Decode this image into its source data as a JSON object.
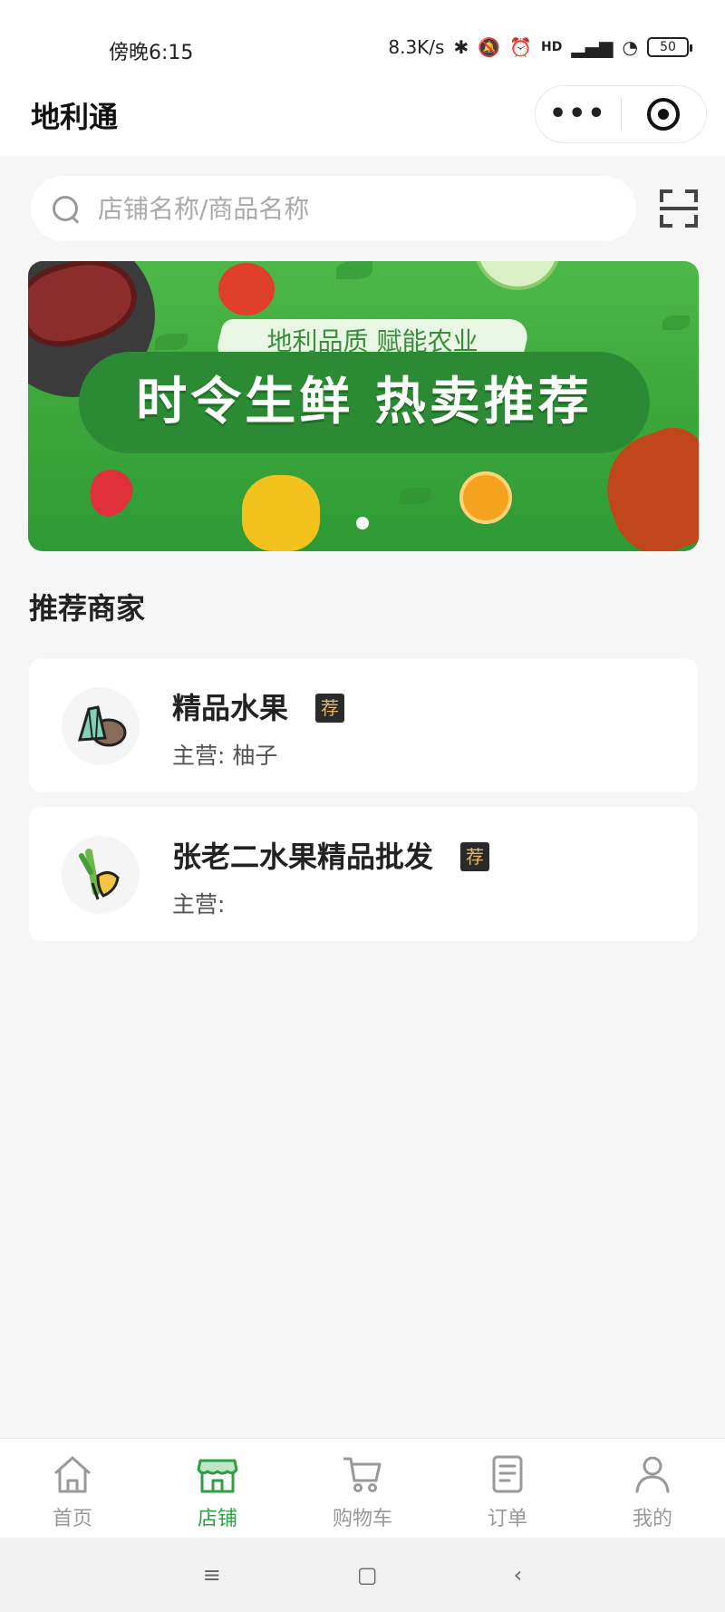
{
  "status_bar": {
    "time": "傍晚6:15",
    "speed": "8.3K/s",
    "signal_label": "HD",
    "battery": "50"
  },
  "nav": {
    "title": "地利通",
    "more_label": "•••"
  },
  "search": {
    "placeholder": "店铺名称/商品名称"
  },
  "banner": {
    "subtitle": "地利品质 赋能农业",
    "title": "时令生鲜 热卖推荐",
    "active_slide": 1,
    "slide_count": 1
  },
  "section": {
    "title": "推荐商家"
  },
  "merchants": [
    {
      "name": "精品水果",
      "badge": "荐",
      "main": "主营: 柚子",
      "icon": "bamboo-shoot-potato-icon"
    },
    {
      "name": "张老二水果精品批发",
      "badge": "荐",
      "main": "主营:",
      "icon": "leek-ginger-icon"
    }
  ],
  "tabbar": {
    "items": [
      {
        "label": "首页",
        "icon": "home-icon",
        "active": false
      },
      {
        "label": "店铺",
        "icon": "store-icon",
        "active": true
      },
      {
        "label": "购物车",
        "icon": "cart-icon",
        "active": false
      },
      {
        "label": "订单",
        "icon": "order-icon",
        "active": false
      },
      {
        "label": "我的",
        "icon": "profile-icon",
        "active": false
      }
    ]
  },
  "colors": {
    "accent": "#2f9e44",
    "badge_bg": "#2a2a2a",
    "badge_text": "#e3b76a",
    "banner_green": "#3aa63a"
  },
  "system_nav": {
    "menu": "≡",
    "home": "▢",
    "back": "‹"
  }
}
